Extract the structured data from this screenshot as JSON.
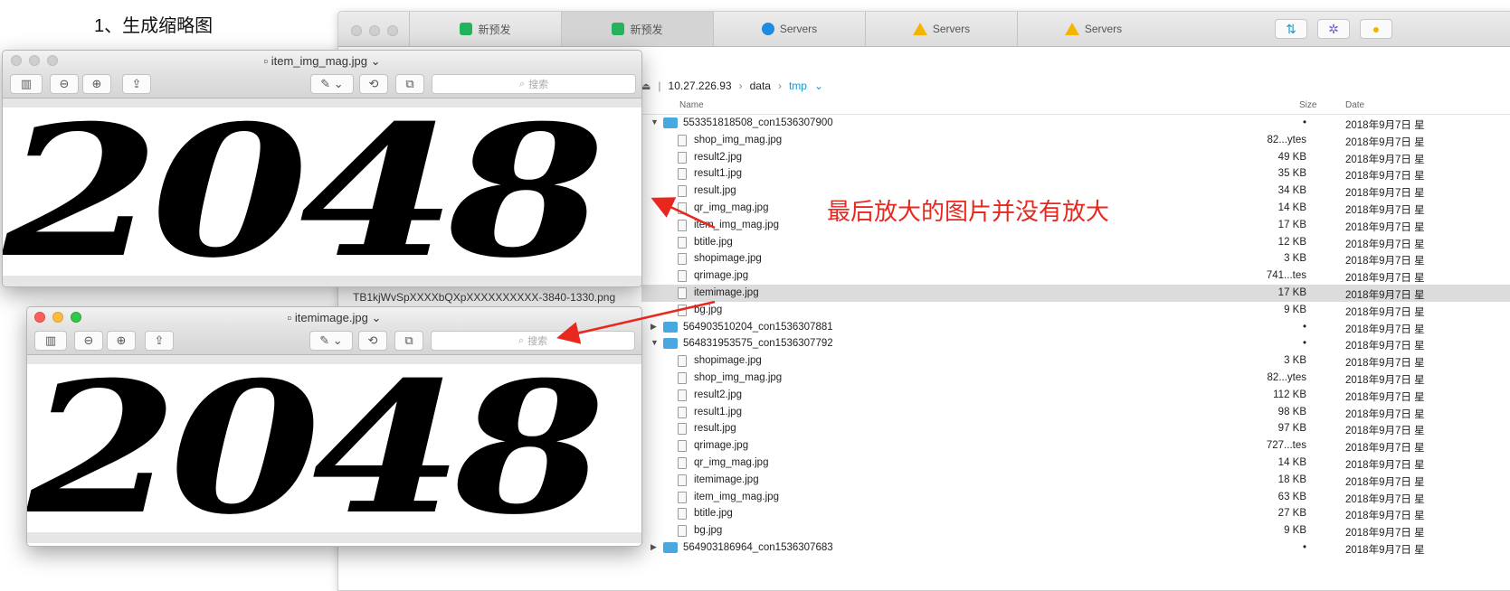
{
  "heading": "1、生成缩略图",
  "finder": {
    "tabs": [
      {
        "label": "新预发",
        "icon": "green-tab-icon",
        "active": false
      },
      {
        "label": "新预发",
        "icon": "green-tab-icon",
        "active": true
      },
      {
        "label": "Servers",
        "icon": "globe-icon",
        "active": false
      },
      {
        "label": "Servers",
        "icon": "warning-icon",
        "active": false
      },
      {
        "label": "Servers",
        "icon": "warning-icon",
        "active": false
      }
    ],
    "path": {
      "host": "10.27.226.93",
      "dir": "data",
      "current": "tmp"
    },
    "columns": {
      "name": "Name",
      "size": "Size",
      "date": "Date"
    },
    "rows": [
      {
        "type": "folder",
        "open": true,
        "name": "553351818508_con1536307900",
        "size": "•",
        "date": "2018年9月7日 星"
      },
      {
        "type": "file",
        "name": "shop_img_mag.jpg",
        "size": "82...ytes",
        "date": "2018年9月7日 星"
      },
      {
        "type": "file",
        "name": "result2.jpg",
        "size": "49 KB",
        "date": "2018年9月7日 星"
      },
      {
        "type": "file",
        "name": "result1.jpg",
        "size": "35 KB",
        "date": "2018年9月7日 星"
      },
      {
        "type": "file",
        "name": "result.jpg",
        "size": "34 KB",
        "date": "2018年9月7日 星"
      },
      {
        "type": "file",
        "name": "qr_img_mag.jpg",
        "size": "14 KB",
        "date": "2018年9月7日 星"
      },
      {
        "type": "file",
        "name": "item_img_mag.jpg",
        "size": "17 KB",
        "date": "2018年9月7日 星"
      },
      {
        "type": "file",
        "name": "btitle.jpg",
        "size": "12 KB",
        "date": "2018年9月7日 星"
      },
      {
        "type": "file",
        "name": "shopimage.jpg",
        "size": "3 KB",
        "date": "2018年9月7日 星"
      },
      {
        "type": "file",
        "name": "qrimage.jpg",
        "size": "741...tes",
        "date": "2018年9月7日 星"
      },
      {
        "type": "file",
        "name": "itemimage.jpg",
        "size": "17 KB",
        "date": "2018年9月7日 星",
        "selected": true
      },
      {
        "type": "file",
        "name": "bg.jpg",
        "size": "9 KB",
        "date": "2018年9月7日 星"
      },
      {
        "type": "folder",
        "open": false,
        "name": "564903510204_con1536307881",
        "size": "•",
        "date": "2018年9月7日 星"
      },
      {
        "type": "folder",
        "open": true,
        "name": "564831953575_con1536307792",
        "size": "•",
        "date": "2018年9月7日 星"
      },
      {
        "type": "file",
        "name": "shopimage.jpg",
        "size": "3 KB",
        "date": "2018年9月7日 星"
      },
      {
        "type": "file",
        "name": "shop_img_mag.jpg",
        "size": "82...ytes",
        "date": "2018年9月7日 星"
      },
      {
        "type": "file",
        "name": "result2.jpg",
        "size": "112 KB",
        "date": "2018年9月7日 星"
      },
      {
        "type": "file",
        "name": "result1.jpg",
        "size": "98 KB",
        "date": "2018年9月7日 星"
      },
      {
        "type": "file",
        "name": "result.jpg",
        "size": "97 KB",
        "date": "2018年9月7日 星"
      },
      {
        "type": "file",
        "name": "qrimage.jpg",
        "size": "727...tes",
        "date": "2018年9月7日 星"
      },
      {
        "type": "file",
        "name": "qr_img_mag.jpg",
        "size": "14 KB",
        "date": "2018年9月7日 星"
      },
      {
        "type": "file",
        "name": "itemimage.jpg",
        "size": "18 KB",
        "date": "2018年9月7日 星"
      },
      {
        "type": "file",
        "name": "item_img_mag.jpg",
        "size": "63 KB",
        "date": "2018年9月7日 星"
      },
      {
        "type": "file",
        "name": "btitle.jpg",
        "size": "27 KB",
        "date": "2018年9月7日 星"
      },
      {
        "type": "file",
        "name": "bg.jpg",
        "size": "9 KB",
        "date": "2018年9月7日 星"
      },
      {
        "type": "folder",
        "open": false,
        "name": "564903186964_con1536307683",
        "size": "•",
        "date": "2018年9月7日 星"
      }
    ]
  },
  "annotation": "最后放大的图片并没有放大",
  "behind_file": "TB1kjWvSpXXXXbQXpXXXXXXXXXX-3840-1330.png",
  "preview1": {
    "title": "item_img_mag.jpg",
    "search_placeholder": "搜索",
    "image_text": "2048"
  },
  "preview2": {
    "title": "itemimage.jpg",
    "search_placeholder": "搜索",
    "image_text": "2048"
  },
  "colors": {
    "annotation": "#e8281f",
    "accent": "#1a9ac9",
    "folder": "#4aa8e0"
  }
}
